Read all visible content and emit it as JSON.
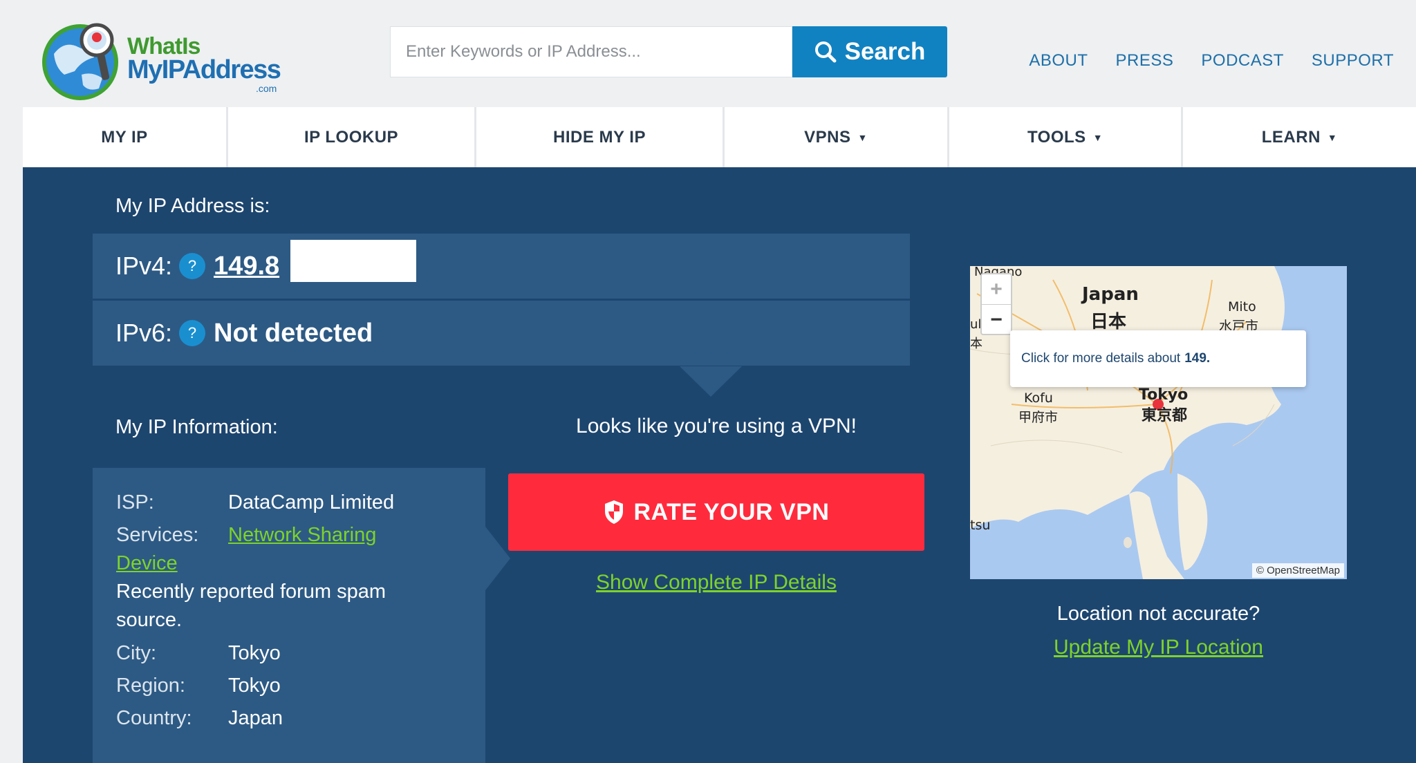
{
  "header": {
    "logo": {
      "line1": "WhatIs",
      "line2": "MyIPAddress",
      "line3": ".com"
    },
    "search": {
      "placeholder": "Enter Keywords or IP Address...",
      "button_label": "Search"
    },
    "links": [
      "ABOUT",
      "PRESS",
      "PODCAST",
      "SUPPORT"
    ]
  },
  "nav": {
    "items": [
      {
        "label": "MY IP",
        "dropdown": false
      },
      {
        "label": "IP LOOKUP",
        "dropdown": false
      },
      {
        "label": "HIDE MY IP",
        "dropdown": false
      },
      {
        "label": "VPNS",
        "dropdown": true
      },
      {
        "label": "TOOLS",
        "dropdown": true
      },
      {
        "label": "LEARN",
        "dropdown": true
      }
    ],
    "caret": "▼"
  },
  "ip": {
    "heading": "My IP Address is:",
    "ipv4_label": "IPv4:",
    "ipv4_value": "149.8",
    "ipv6_label": "IPv6:",
    "ipv6_value": "Not detected",
    "help_glyph": "?"
  },
  "info": {
    "heading": "My IP Information:",
    "isp_label": "ISP:",
    "isp_value": "DataCamp Limited",
    "services_label": "Services:",
    "services_link_line1": "Network Sharing",
    "services_link_line2": "Device",
    "note_line1": "Recently reported forum spam",
    "note_line2": "source.",
    "city_label": "City:",
    "city_value": "Tokyo",
    "region_label": "Region:",
    "region_value": "Tokyo",
    "country_label": "Country:",
    "country_value": "Japan"
  },
  "vpn": {
    "message": "Looks like you're using a VPN!",
    "rate_button": "RATE YOUR VPN",
    "details_link": "Show Complete IP Details"
  },
  "map": {
    "popup_text": "Click for more details about",
    "popup_ip": "149.",
    "zoom_in": "+",
    "zoom_out": "−",
    "attribution": "© OpenStreetMap",
    "labels": {
      "nagano": "Nagano",
      "japan": "Japan",
      "japan_kanji": "日本",
      "mito": "Mito",
      "mito_kanji": "水戸市",
      "kofu": "Kofu",
      "kofu_kanji": "甲府市",
      "tokyo": "Tokyo",
      "tokyo_kanji": "東京都",
      "edge1": "ul",
      "edge2": "本",
      "edge3": "tsu",
      "edge4": "市"
    },
    "colors": {
      "sea": "#aac9f0",
      "land": "#f5efe0",
      "marker": "#e8323c"
    }
  },
  "location": {
    "question": "Location not accurate?",
    "update_link": "Update My IP Location"
  },
  "colors": {
    "main_bg": "#1d466f",
    "panel_bg": "#2d5a84",
    "accent_blue": "#1182c1",
    "rate_red": "#ff2b3d",
    "link_green": "#7ed32a"
  }
}
